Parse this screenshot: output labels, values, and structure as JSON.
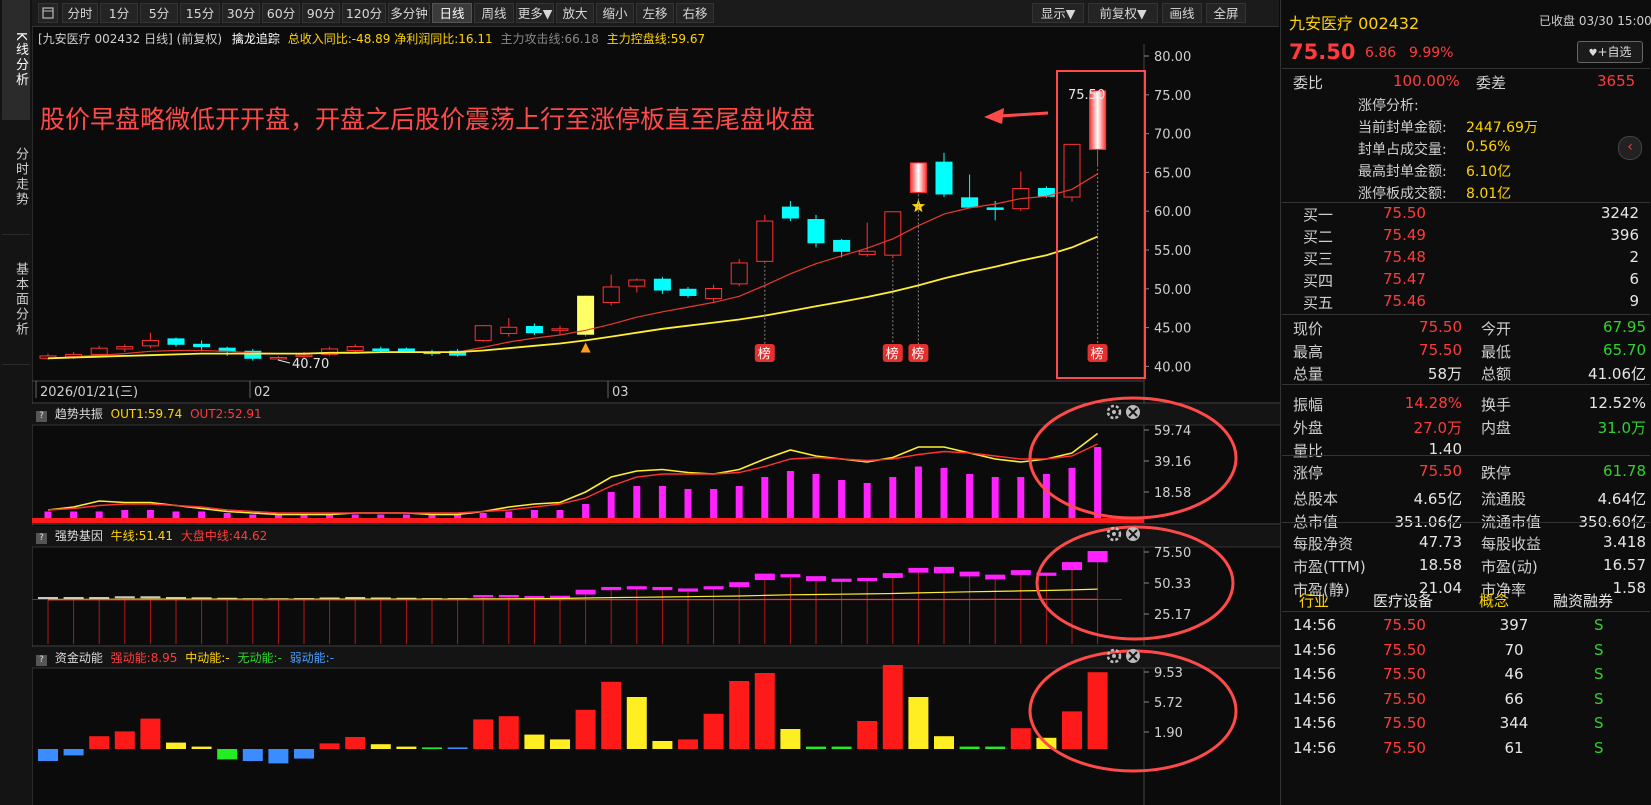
{
  "left_tabs": [
    "K线分析",
    "分时走势",
    "基本面分析"
  ],
  "toolbar": {
    "periods": [
      "分时",
      "1分",
      "5分",
      "15分",
      "30分",
      "60分",
      "90分",
      "120分",
      "多分钟",
      "日线",
      "周线",
      "更多▼",
      "放大",
      "缩小",
      "左移",
      "右移"
    ],
    "active_period": "日线",
    "right_buttons": [
      "显示▼",
      "前复权▼",
      "画线",
      "全屏"
    ]
  },
  "chart_header": {
    "stock": "[九安医疗 002432 日线]",
    "adj": "(前复权)",
    "indicator": "擒龙追踪",
    "revenue_yoy": "总收入同比:-48.89",
    "profit_yoy": "净利润同比:16.11",
    "attack": "主力攻击线:66.18",
    "control": "主力控盘线:59.67"
  },
  "annotation": "股价早盘略微低开开盘，开盘之后股价震荡上行至涨停板直至尾盘收盘",
  "price_axis": [
    "80.00",
    "75.00",
    "70.00",
    "65.00",
    "60.00",
    "55.00",
    "50.00",
    "45.00",
    "40.00"
  ],
  "date_axis": [
    "2026/01/21(三)",
    "02",
    "03"
  ],
  "last_price_label": "75.50",
  "low_label": "40.70",
  "list_tag": "榜",
  "panel1": {
    "title": "趋势共振",
    "out1": "OUT1:59.74",
    "out2": "OUT2:52.91",
    "axis": [
      "59.74",
      "39.16",
      "18.58"
    ]
  },
  "panel2": {
    "title": "强势基因",
    "bull": "牛线:51.41",
    "market": "大盘中线:44.62",
    "axis": [
      "75.50",
      "50.33",
      "25.17"
    ]
  },
  "panel3": {
    "title": "资金动能",
    "strong": "强动能:8.95",
    "mid": "中动能:-",
    "none": "无动能:-",
    "weak": "弱动能:-",
    "axis": [
      "9.53",
      "5.72",
      "1.90"
    ]
  },
  "quote": {
    "name": "九安医疗 002432",
    "status": "已收盘 03/30 15:00",
    "price": "75.50",
    "change": "6.86",
    "pct": "9.99%",
    "fav_button": "+自选",
    "weibi_label": "委比",
    "weibi": "100.00%",
    "weicha_label": "委差",
    "weicha": "3655",
    "limit_title": "涨停分析:",
    "limit_rows": [
      {
        "label": "当前封单金额:",
        "value": "2447.69万"
      },
      {
        "label": "封单占成交量:",
        "value": "0.56%"
      },
      {
        "label": "最高封单金额:",
        "value": "6.10亿"
      },
      {
        "label": "涨停板成交额:",
        "value": "8.01亿"
      }
    ],
    "bids": [
      {
        "label": "买一",
        "price": "75.50",
        "vol": "3242"
      },
      {
        "label": "买二",
        "price": "75.49",
        "vol": "396"
      },
      {
        "label": "买三",
        "price": "75.48",
        "vol": "2"
      },
      {
        "label": "买四",
        "price": "75.47",
        "vol": "6"
      },
      {
        "label": "买五",
        "price": "75.46",
        "vol": "9"
      }
    ],
    "stats": [
      {
        "l1": "现价",
        "v1": "75.50",
        "c1": "red",
        "l2": "今开",
        "v2": "67.95",
        "c2": "grn"
      },
      {
        "l1": "最高",
        "v1": "75.50",
        "c1": "red",
        "l2": "最低",
        "v2": "65.70",
        "c2": "grn"
      },
      {
        "l1": "总量",
        "v1": "58万",
        "c1": "wht",
        "l2": "总额",
        "v2": "41.06亿",
        "c2": "wht"
      },
      {
        "l1": "振幅",
        "v1": "14.28%",
        "c1": "red",
        "l2": "换手",
        "v2": "12.52%",
        "c2": "wht"
      },
      {
        "l1": "外盘",
        "v1": "27.0万",
        "c1": "red",
        "l2": "内盘",
        "v2": "31.0万",
        "c2": "grn"
      },
      {
        "l1": "量比",
        "v1": "1.40",
        "c1": "wht",
        "l2": "",
        "v2": "",
        "c2": "wht"
      },
      {
        "l1": "涨停",
        "v1": "75.50",
        "c1": "red",
        "l2": "跌停",
        "v2": "61.78",
        "c2": "grn"
      },
      {
        "l1": "总股本",
        "v1": "4.65亿",
        "c1": "wht",
        "l2": "流通股",
        "v2": "4.64亿",
        "c2": "wht"
      },
      {
        "l1": "总市值",
        "v1": "351.06亿",
        "c1": "wht",
        "l2": "流通市值",
        "v2": "350.60亿",
        "c2": "wht"
      },
      {
        "l1": "每股净资",
        "v1": "47.73",
        "c1": "wht",
        "l2": "每股收益",
        "v2": "3.418",
        "c2": "wht"
      },
      {
        "l1": "市盈(TTM)",
        "v1": "18.58",
        "c1": "wht",
        "l2": "市盈(动)",
        "v2": "16.57",
        "c2": "wht"
      },
      {
        "l1": "市盈(静)",
        "v1": "21.04",
        "c1": "wht",
        "l2": "市净率",
        "v2": "1.58",
        "c2": "wht"
      }
    ],
    "sector_tabs": [
      "行业",
      "医疗设备",
      "概念",
      "融资融券"
    ],
    "ticks": [
      {
        "time": "14:56",
        "price": "75.50",
        "vol": "397",
        "side": "S"
      },
      {
        "time": "14:56",
        "price": "75.50",
        "vol": "70",
        "side": "S"
      },
      {
        "time": "14:56",
        "price": "75.50",
        "vol": "46",
        "side": "S"
      },
      {
        "time": "14:56",
        "price": "75.50",
        "vol": "66",
        "side": "S"
      },
      {
        "time": "14:56",
        "price": "75.50",
        "vol": "344",
        "side": "S"
      },
      {
        "time": "14:56",
        "price": "75.50",
        "vol": "61",
        "side": "S"
      }
    ]
  },
  "chart_data": {
    "type": "candlestick",
    "y_range": [
      40,
      80
    ],
    "candles": [
      {
        "o": 41.0,
        "h": 41.6,
        "l": 40.8,
        "c": 41.3
      },
      {
        "o": 41.2,
        "h": 41.8,
        "l": 40.9,
        "c": 41.5
      },
      {
        "o": 41.5,
        "h": 42.6,
        "l": 41.3,
        "c": 42.3
      },
      {
        "o": 42.2,
        "h": 42.8,
        "l": 41.8,
        "c": 42.5
      },
      {
        "o": 42.6,
        "h": 44.3,
        "l": 42.3,
        "c": 43.3
      },
      {
        "o": 43.5,
        "h": 43.7,
        "l": 42.5,
        "c": 42.8
      },
      {
        "o": 42.8,
        "h": 43.3,
        "l": 41.9,
        "c": 42.5
      },
      {
        "o": 42.3,
        "h": 42.5,
        "l": 41.3,
        "c": 41.9
      },
      {
        "o": 41.9,
        "h": 42.2,
        "l": 40.7,
        "c": 41.0
      },
      {
        "o": 41.0,
        "h": 41.3,
        "l": 40.7,
        "c": 41.1
      },
      {
        "o": 41.3,
        "h": 41.8,
        "l": 40.9,
        "c": 41.4
      },
      {
        "o": 41.5,
        "h": 42.5,
        "l": 41.3,
        "c": 42.2
      },
      {
        "o": 42.0,
        "h": 42.8,
        "l": 41.8,
        "c": 42.5
      },
      {
        "o": 42.2,
        "h": 42.5,
        "l": 41.8,
        "c": 42.0
      },
      {
        "o": 42.2,
        "h": 42.4,
        "l": 41.7,
        "c": 41.9
      },
      {
        "o": 41.8,
        "h": 42.1,
        "l": 41.3,
        "c": 41.6
      },
      {
        "o": 41.9,
        "h": 42.2,
        "l": 41.2,
        "c": 41.4
      },
      {
        "o": 43.3,
        "h": 45.3,
        "l": 43.1,
        "c": 45.2
      },
      {
        "o": 44.2,
        "h": 46.2,
        "l": 43.8,
        "c": 45.0
      },
      {
        "o": 45.1,
        "h": 45.5,
        "l": 44.0,
        "c": 44.3
      },
      {
        "o": 44.7,
        "h": 45.2,
        "l": 44.0,
        "c": 44.8
      },
      {
        "o": 44.1,
        "h": 49.1,
        "l": 43.8,
        "c": 49.0
      },
      {
        "o": 48.2,
        "h": 51.8,
        "l": 47.8,
        "c": 50.2
      },
      {
        "o": 50.3,
        "h": 51.3,
        "l": 49.5,
        "c": 51.1
      },
      {
        "o": 51.2,
        "h": 51.5,
        "l": 49.3,
        "c": 49.8
      },
      {
        "o": 49.9,
        "h": 50.2,
        "l": 48.8,
        "c": 49.1
      },
      {
        "o": 48.7,
        "h": 50.5,
        "l": 48.2,
        "c": 50.0
      },
      {
        "o": 50.6,
        "h": 53.8,
        "l": 50.3,
        "c": 53.3
      },
      {
        "o": 53.5,
        "h": 59.5,
        "l": 53.2,
        "c": 58.7
      },
      {
        "o": 60.5,
        "h": 61.3,
        "l": 58.7,
        "c": 59.1
      },
      {
        "o": 58.9,
        "h": 59.5,
        "l": 55.3,
        "c": 55.9
      },
      {
        "o": 56.2,
        "h": 56.4,
        "l": 54.0,
        "c": 54.8
      },
      {
        "o": 54.4,
        "h": 58.5,
        "l": 54.1,
        "c": 54.8
      },
      {
        "o": 54.3,
        "h": 59.8,
        "l": 53.9,
        "c": 59.9
      },
      {
        "o": 62.4,
        "h": 66.3,
        "l": 62.4,
        "c": 66.2
      },
      {
        "o": 66.3,
        "h": 67.5,
        "l": 61.8,
        "c": 62.2
      },
      {
        "o": 61.7,
        "h": 64.7,
        "l": 60.7,
        "c": 60.5
      },
      {
        "o": 60.4,
        "h": 61.3,
        "l": 58.8,
        "c": 60.2
      },
      {
        "o": 60.3,
        "h": 65.1,
        "l": 60.0,
        "c": 62.9
      },
      {
        "o": 62.9,
        "h": 63.2,
        "l": 61.7,
        "c": 61.9
      },
      {
        "o": 61.8,
        "h": 68.6,
        "l": 61.2,
        "c": 68.6
      },
      {
        "o": 67.95,
        "h": 75.5,
        "l": 65.7,
        "c": 75.5
      }
    ],
    "ma_red": [
      41.0,
      41.2,
      41.4,
      41.6,
      41.9,
      42.0,
      42.0,
      41.9,
      41.7,
      41.6,
      41.6,
      41.7,
      41.8,
      41.8,
      41.8,
      41.8,
      41.8,
      42.4,
      43.1,
      43.6,
      44.0,
      44.6,
      45.4,
      46.3,
      47.0,
      47.6,
      48.2,
      49.0,
      50.4,
      51.9,
      53.2,
      54.2,
      55.2,
      56.4,
      58.1,
      59.6,
      60.4,
      60.9,
      61.6,
      61.9,
      62.8,
      64.8
    ],
    "ma_yellow": [
      41.0,
      41.1,
      41.2,
      41.3,
      41.4,
      41.5,
      41.6,
      41.6,
      41.6,
      41.6,
      41.6,
      41.7,
      41.7,
      41.8,
      41.8,
      41.8,
      41.8,
      42.0,
      42.3,
      42.6,
      42.9,
      43.3,
      43.8,
      44.3,
      44.8,
      45.2,
      45.6,
      46.0,
      46.5,
      47.1,
      47.7,
      48.3,
      48.9,
      49.6,
      50.4,
      51.3,
      52.1,
      52.8,
      53.6,
      54.3,
      55.3,
      56.7
    ],
    "list_tag_indices": [
      28,
      33,
      34,
      41
    ],
    "rocket_index": 21,
    "star_index": 34,
    "panel1_bars": [
      5,
      5,
      5,
      6,
      6,
      5,
      5,
      4,
      3,
      3,
      3,
      3,
      3,
      3,
      3,
      3,
      3,
      4,
      5,
      6,
      6,
      10,
      18,
      22,
      22,
      20,
      20,
      22,
      28,
      32,
      30,
      26,
      24,
      28,
      35,
      34,
      30,
      28,
      28,
      30,
      34,
      48
    ],
    "panel1_out1": [
      6,
      8,
      12,
      11,
      11,
      9,
      7,
      5,
      4,
      3,
      3,
      3,
      4,
      4,
      4,
      3,
      3,
      5,
      8,
      10,
      11,
      18,
      28,
      32,
      33,
      31,
      30,
      33,
      40,
      46,
      42,
      40,
      38,
      41,
      48,
      48,
      44,
      40,
      38,
      40,
      44,
      57
    ],
    "panel1_out2": [
      6,
      7,
      9,
      10,
      10,
      9,
      8,
      6,
      5,
      4,
      4,
      4,
      4,
      4,
      4,
      4,
      4,
      5,
      6,
      8,
      10,
      14,
      22,
      28,
      30,
      30,
      30,
      31,
      35,
      40,
      41,
      40,
      39,
      40,
      43,
      45,
      44,
      42,
      40,
      40,
      42,
      50
    ],
    "panel2_blocks": [
      {
        "v": 45.5,
        "h": 1
      },
      {
        "v": 45.5,
        "h": 1
      },
      {
        "v": 45.5,
        "h": 1
      },
      {
        "v": 46,
        "h": 1
      },
      {
        "v": 46,
        "h": 1
      },
      {
        "v": 45.5,
        "h": 1
      },
      {
        "v": 45.3,
        "h": 1
      },
      {
        "v": 45,
        "h": 1
      },
      {
        "v": 44.7,
        "h": 1
      },
      {
        "v": 44.7,
        "h": 1
      },
      {
        "v": 44.8,
        "h": 1
      },
      {
        "v": 45.2,
        "h": 1
      },
      {
        "v": 45.5,
        "h": 1
      },
      {
        "v": 45.2,
        "h": 1
      },
      {
        "v": 45,
        "h": 1
      },
      {
        "v": 44.8,
        "h": 1
      },
      {
        "v": 44.8,
        "h": 1
      },
      {
        "v": 46.5,
        "h": 1.5
      },
      {
        "v": 46.5,
        "h": 1.5
      },
      {
        "v": 45.8,
        "h": 1.5
      },
      {
        "v": 46,
        "h": 1.5
      },
      {
        "v": 49,
        "h": 3
      },
      {
        "v": 51.5,
        "h": 2
      },
      {
        "v": 52,
        "h": 2
      },
      {
        "v": 51.5,
        "h": 2
      },
      {
        "v": 50.5,
        "h": 2
      },
      {
        "v": 52,
        "h": 2
      },
      {
        "v": 54,
        "h": 3
      },
      {
        "v": 59,
        "h": 4
      },
      {
        "v": 60,
        "h": 2
      },
      {
        "v": 58,
        "h": 3
      },
      {
        "v": 57,
        "h": 2
      },
      {
        "v": 57.5,
        "h": 2
      },
      {
        "v": 60,
        "h": 3
      },
      {
        "v": 63.5,
        "h": 3
      },
      {
        "v": 63.5,
        "h": 4
      },
      {
        "v": 61,
        "h": 3
      },
      {
        "v": 59,
        "h": 3
      },
      {
        "v": 62,
        "h": 3
      },
      {
        "v": 61,
        "h": 2
      },
      {
        "v": 66,
        "h": 5
      },
      {
        "v": 72,
        "h": 7
      }
    ],
    "panel2_bull": [
      44.5,
      44.6,
      44.6,
      44.7,
      44.8,
      44.8,
      44.8,
      44.8,
      44.7,
      44.7,
      44.7,
      44.8,
      44.8,
      44.8,
      44.8,
      44.8,
      44.8,
      44.9,
      45.0,
      45.1,
      45.2,
      45.5,
      45.8,
      46.0,
      46.2,
      46.4,
      46.6,
      46.8,
      47.2,
      47.6,
      47.8,
      48.0,
      48.2,
      48.5,
      48.9,
      49.3,
      49.6,
      49.9,
      50.2,
      50.5,
      50.9,
      51.4
    ],
    "panel2_market": [
      44.3,
      44.3,
      44.3,
      44.3,
      44.3,
      44.3,
      44.3,
      44.3,
      44.3,
      44.3,
      44.3,
      44.3,
      44.3,
      44.3,
      44.3,
      44.3,
      44.3,
      44.3,
      44.3,
      44.3,
      44.3,
      44.4,
      44.4,
      44.4,
      44.4,
      44.4,
      44.4,
      44.4,
      44.5,
      44.5,
      44.5,
      44.5,
      44.5,
      44.5,
      44.5,
      44.5,
      44.5,
      44.6,
      44.6,
      44.6,
      44.6,
      44.6
    ],
    "panel3_bars": [
      {
        "v": -1.5,
        "c": "blue"
      },
      {
        "v": -0.8,
        "c": "blue"
      },
      {
        "v": 1.6,
        "c": "red"
      },
      {
        "v": 2.2,
        "c": "red"
      },
      {
        "v": 3.8,
        "c": "red"
      },
      {
        "v": 0.8,
        "c": "yellow"
      },
      {
        "v": 0.3,
        "c": "yellow"
      },
      {
        "v": -1.3,
        "c": "green"
      },
      {
        "v": -1.5,
        "c": "blue"
      },
      {
        "v": -1.8,
        "c": "blue"
      },
      {
        "v": -1.2,
        "c": "blue"
      },
      {
        "v": 0.7,
        "c": "red"
      },
      {
        "v": 1.5,
        "c": "red"
      },
      {
        "v": 0.6,
        "c": "yellow"
      },
      {
        "v": 0.3,
        "c": "yellow"
      },
      {
        "v": 0.2,
        "c": "green"
      },
      {
        "v": 0.2,
        "c": "blue"
      },
      {
        "v": 3.7,
        "c": "red"
      },
      {
        "v": 4.1,
        "c": "red"
      },
      {
        "v": 1.8,
        "c": "yellow"
      },
      {
        "v": 1.2,
        "c": "yellow"
      },
      {
        "v": 4.9,
        "c": "red"
      },
      {
        "v": 8.4,
        "c": "red"
      },
      {
        "v": 6.5,
        "c": "yellow"
      },
      {
        "v": 1.0,
        "c": "yellow"
      },
      {
        "v": 1.2,
        "c": "red"
      },
      {
        "v": 4.4,
        "c": "red"
      },
      {
        "v": 8.5,
        "c": "red"
      },
      {
        "v": 9.5,
        "c": "red"
      },
      {
        "v": 2.5,
        "c": "yellow"
      },
      {
        "v": 0.3,
        "c": "green"
      },
      {
        "v": 0.3,
        "c": "green"
      },
      {
        "v": 3.5,
        "c": "red"
      },
      {
        "v": 10.5,
        "c": "red"
      },
      {
        "v": 6.5,
        "c": "yellow"
      },
      {
        "v": 1.6,
        "c": "yellow"
      },
      {
        "v": 0.3,
        "c": "green"
      },
      {
        "v": 0.3,
        "c": "green"
      },
      {
        "v": 2.6,
        "c": "red"
      },
      {
        "v": 1.4,
        "c": "yellow"
      },
      {
        "v": 4.7,
        "c": "red"
      },
      {
        "v": 9.6,
        "c": "red"
      }
    ]
  },
  "colors": {
    "up": "#ff3333",
    "down": "#00ffff",
    "ma_red": "#e83a2e",
    "ma_yellow": "#ffee33",
    "magenta": "#ff22ff",
    "annotation": "#ff4a4a"
  }
}
